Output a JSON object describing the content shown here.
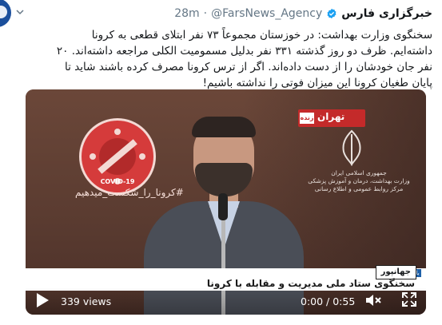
{
  "author": {
    "name": "خبرگزاری فارس",
    "handle": "@FarsNews_Agency",
    "separator": "·",
    "time": "28m"
  },
  "tweet_lines": [
    "سخنگوی وزارت بهداشت: در خوزستان مجموعاً ۷۳ نفر ابتلای قطعی به کرونا",
    "داشته‌ایم. ظرف دو روز گذشته ۳۳۱ نفر بدلیل مسمومیت الکلی مراجعه داشته‌اند. ۲۰",
    "نفر جان خودشان را از دست داده‌اند. اگر از ترس کرونا مصرف کرده باشند شاید تا",
    "پایان طغیان کرونا این میزان فوتی را نداشته باشیم!"
  ],
  "video": {
    "channel_logo": "تهران",
    "live_label": "زنده",
    "campaign_hashtag": "#کرونا_را_شکست_میدهیم",
    "badge_caption": "COVID-19",
    "ministry_lines": [
      "جمهوری اسلامی ایران",
      "وزارت بهداشت، درمان و آموزش پزشکی",
      "مرکز روابط عمومی و اطلاع رسانی"
    ],
    "speaker_name": "جهانپور",
    "speaker_title": "سخنگوی ستاد ملی مدیریت و مقابله با کرونا",
    "lower_tag": "بازشبکه یک",
    "views": "339 views",
    "time": "0:00 / 0:55"
  },
  "icons": {
    "verified": "verified-badge-icon",
    "play": "play-icon",
    "mute": "mute-icon",
    "fullscreen": "fullscreen-icon",
    "chevron": "chevron-down-icon"
  },
  "colors": {
    "verified": "#1da1f2",
    "meta": "#657786",
    "text": "#14171a",
    "logo_red": "#c42a2a"
  }
}
